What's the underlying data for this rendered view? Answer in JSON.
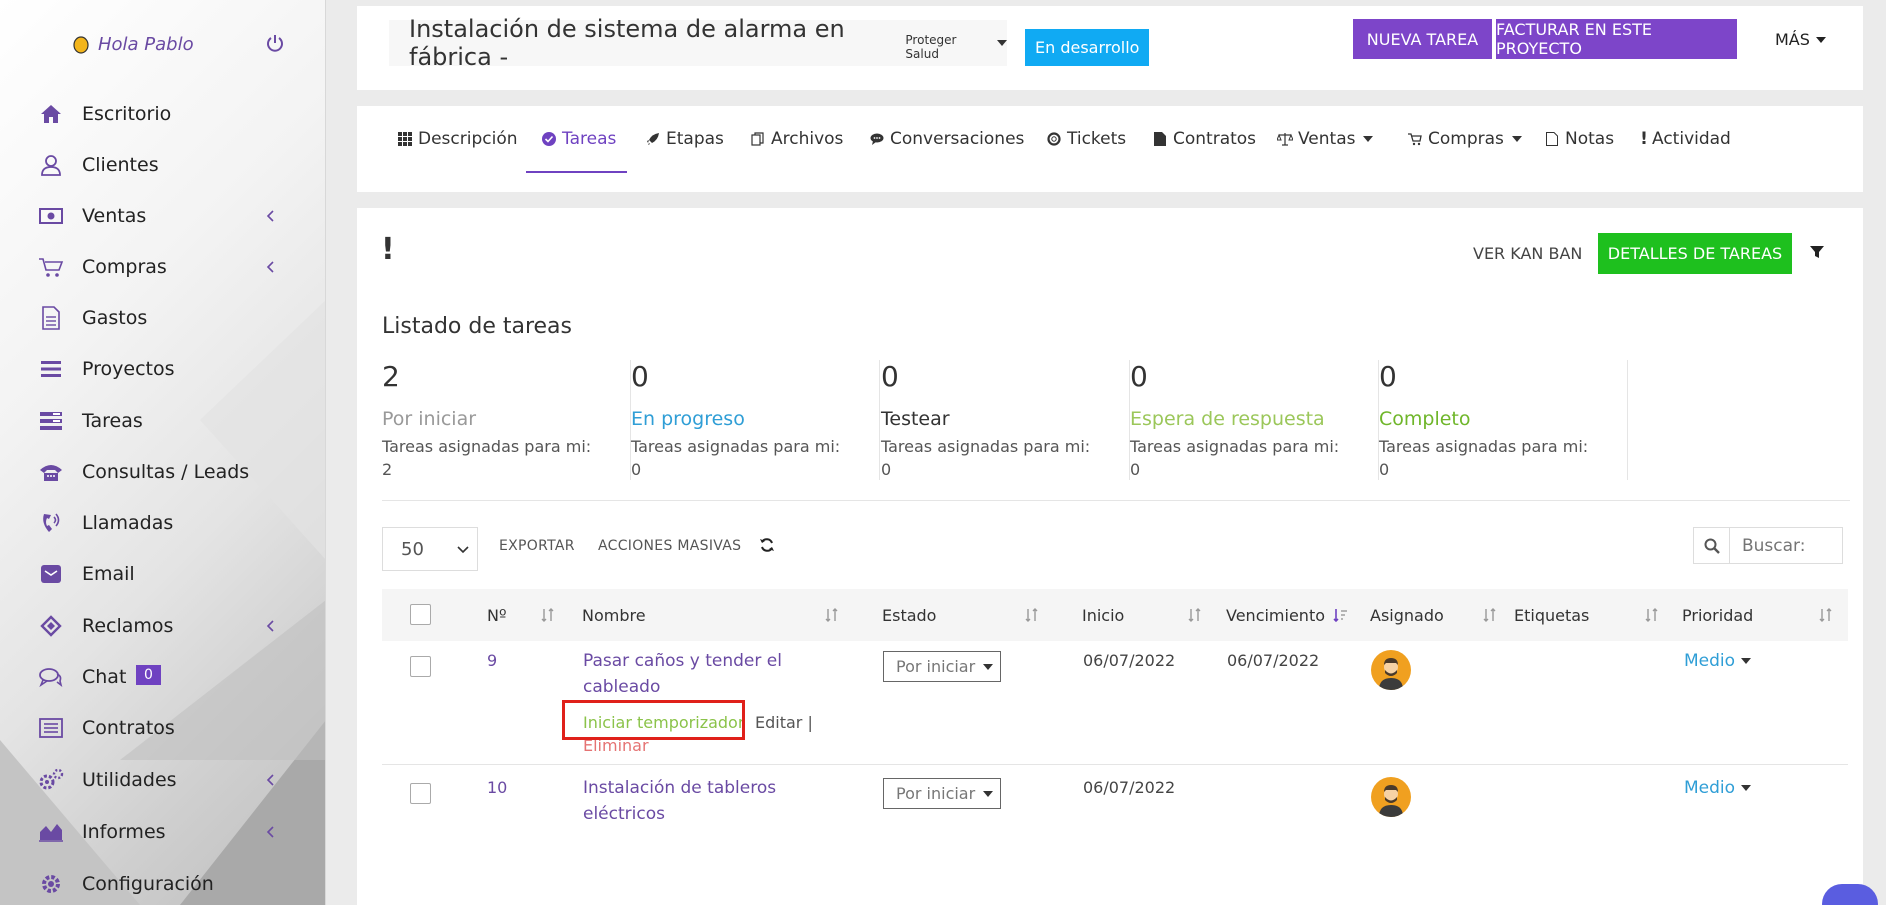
{
  "user": {
    "greeting": "Hola Pablo"
  },
  "sidebar": {
    "items": [
      {
        "label": "Escritorio",
        "icon": "home-icon",
        "has_submenu": false
      },
      {
        "label": "Clientes",
        "icon": "user-icon",
        "has_submenu": false
      },
      {
        "label": "Ventas",
        "icon": "money-icon",
        "has_submenu": true
      },
      {
        "label": "Compras",
        "icon": "cart-icon",
        "has_submenu": true
      },
      {
        "label": "Gastos",
        "icon": "document-icon",
        "has_submenu": false
      },
      {
        "label": "Proyectos",
        "icon": "bars-icon",
        "has_submenu": false
      },
      {
        "label": "Tareas",
        "icon": "tasks-icon",
        "has_submenu": false
      },
      {
        "label": "Consultas / Leads",
        "icon": "phone-icon",
        "has_submenu": false
      },
      {
        "label": "Llamadas",
        "icon": "phone-volume-icon",
        "has_submenu": false
      },
      {
        "label": "Email",
        "icon": "envelope-icon",
        "has_submenu": false
      },
      {
        "label": "Reclamos",
        "icon": "ticket-icon",
        "has_submenu": true
      },
      {
        "label": "Chat",
        "icon": "comments-icon",
        "has_submenu": false,
        "badge": "0"
      },
      {
        "label": "Contratos",
        "icon": "list-alt-icon",
        "has_submenu": false
      },
      {
        "label": "Utilidades",
        "icon": "cogs-icon",
        "has_submenu": true
      },
      {
        "label": "Informes",
        "icon": "area-chart-icon",
        "has_submenu": true
      },
      {
        "label": "Configuración",
        "icon": "gear-icon",
        "has_submenu": false
      }
    ]
  },
  "header": {
    "project_title": "Instalación de sistema de alarma en fábrica -",
    "client": "Proteger Salud",
    "status": "En desarrollo",
    "new_task_label": "NUEVA TAREA",
    "invoice_label": "FACTURAR EN ESTE PROYECTO",
    "more_label": "MÁS"
  },
  "tabs": [
    {
      "label": "Descripción",
      "icon": "grid-icon"
    },
    {
      "label": "Tareas",
      "icon": "check-circle-icon",
      "active": true
    },
    {
      "label": "Etapas",
      "icon": "rocket-icon"
    },
    {
      "label": "Archivos",
      "icon": "files-icon"
    },
    {
      "label": "Conversaciones",
      "icon": "comment-icon"
    },
    {
      "label": "Tickets",
      "icon": "life-ring-icon"
    },
    {
      "label": "Contratos",
      "icon": "file-icon"
    },
    {
      "label": "Ventas",
      "icon": "balance-icon",
      "dropdown": true
    },
    {
      "label": "Compras",
      "icon": "cart-icon",
      "dropdown": true
    },
    {
      "label": "Notas",
      "icon": "note-icon"
    },
    {
      "label": "Actividad",
      "icon": "exclamation-icon"
    }
  ],
  "main": {
    "bang": "!",
    "kanban_label": "VER KAN BAN",
    "details_label": "DETALLES DE TAREAS",
    "list_title": "Listado de tareas",
    "stats": [
      {
        "count": "2",
        "label": "Por iniciar",
        "sub": "Tareas asignadas para mi:",
        "sub_count": "2",
        "color": "#999999"
      },
      {
        "count": "0",
        "label": "En progreso",
        "sub": "Tareas asignadas para mi:",
        "sub_count": "0",
        "color": "#2f9ed6"
      },
      {
        "count": "0",
        "label": "Testear",
        "sub": "Tareas asignadas para mi:",
        "sub_count": "0",
        "color": "#333333"
      },
      {
        "count": "0",
        "label": "Espera de respuesta",
        "sub": "Tareas asignadas para mi:",
        "sub_count": "0",
        "color": "#9bc75a"
      },
      {
        "count": "0",
        "label": "Completo",
        "sub": "Tareas asignadas para mi:",
        "sub_count": "0",
        "color": "#6fb62a"
      }
    ],
    "toolbar": {
      "per_page": "50",
      "export_label": "EXPORTAR",
      "bulk_label": "ACCIONES MASIVAS",
      "search_placeholder": "Buscar:"
    },
    "table": {
      "columns": [
        "Nº",
        "Nombre",
        "Estado",
        "Inicio",
        "Vencimiento",
        "Asignado",
        "Etiquetas",
        "Prioridad"
      ],
      "rows": [
        {
          "id": "9",
          "name_line1": "Pasar caños y tender el",
          "name_line2": "cableado",
          "estado": "Por iniciar",
          "inicio": "06/07/2022",
          "vencimiento": "06/07/2022",
          "prioridad": "Medio",
          "actions": {
            "timer": "Iniciar temporizador",
            "edit": "Editar |",
            "delete": "Eliminar"
          }
        },
        {
          "id": "10",
          "name_line1": "Instalación de tableros",
          "name_line2": "eléctricos",
          "estado": "Por iniciar",
          "inicio": "06/07/2022",
          "vencimiento": "",
          "prioridad": "Medio"
        }
      ]
    }
  }
}
